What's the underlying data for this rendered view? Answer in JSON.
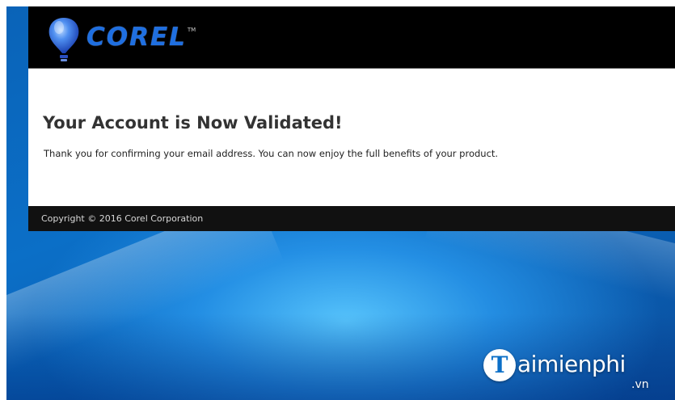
{
  "header": {
    "logo_text": "COREL",
    "logo_tm": "TM",
    "logo_icon": "balloon-icon",
    "logo_color": "#1f6fe0"
  },
  "main": {
    "title": "Your Account is Now Validated!",
    "message": "Thank you for confirming your email address. You can now enjoy the full benefits of your product."
  },
  "footer": {
    "copyright": "Copyright © 2016 Corel Corporation"
  },
  "watermark": {
    "badge_letter": "T",
    "text": "aimienphi",
    "suffix": ".vn"
  },
  "colors": {
    "header_bg": "#000000",
    "footer_bg": "#111111",
    "desktop_blue": "#0b6fc7"
  }
}
